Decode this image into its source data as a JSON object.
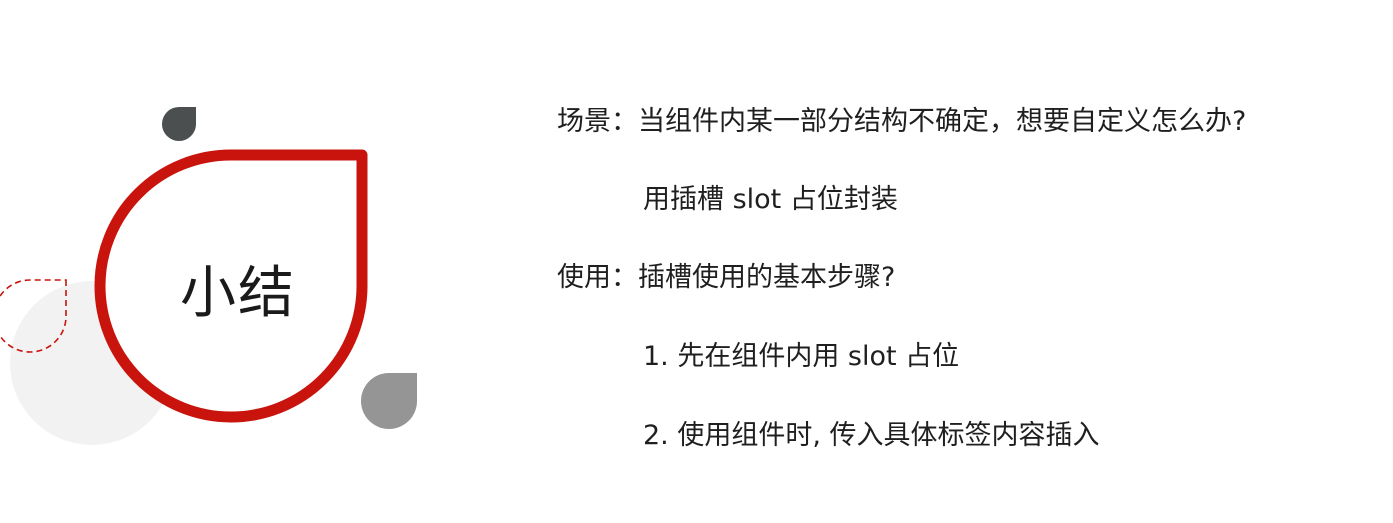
{
  "summary": {
    "title": "小结"
  },
  "content": {
    "scene_question": "场景：当组件内某一部分结构不确定，想要自定义怎么办?",
    "scene_answer": "用插槽 slot 占位封装",
    "usage_question": "使用：插槽使用的基本步骤?",
    "step_1": "1. 先在组件内用 slot 占位",
    "step_2": "2. 使用组件时, 传入具体标签内容插入"
  },
  "colors": {
    "accent_red": "#c8140c",
    "dark_gray": "#4b4f4f",
    "mid_gray": "#959595",
    "light_gray": "#f2f2f2"
  }
}
